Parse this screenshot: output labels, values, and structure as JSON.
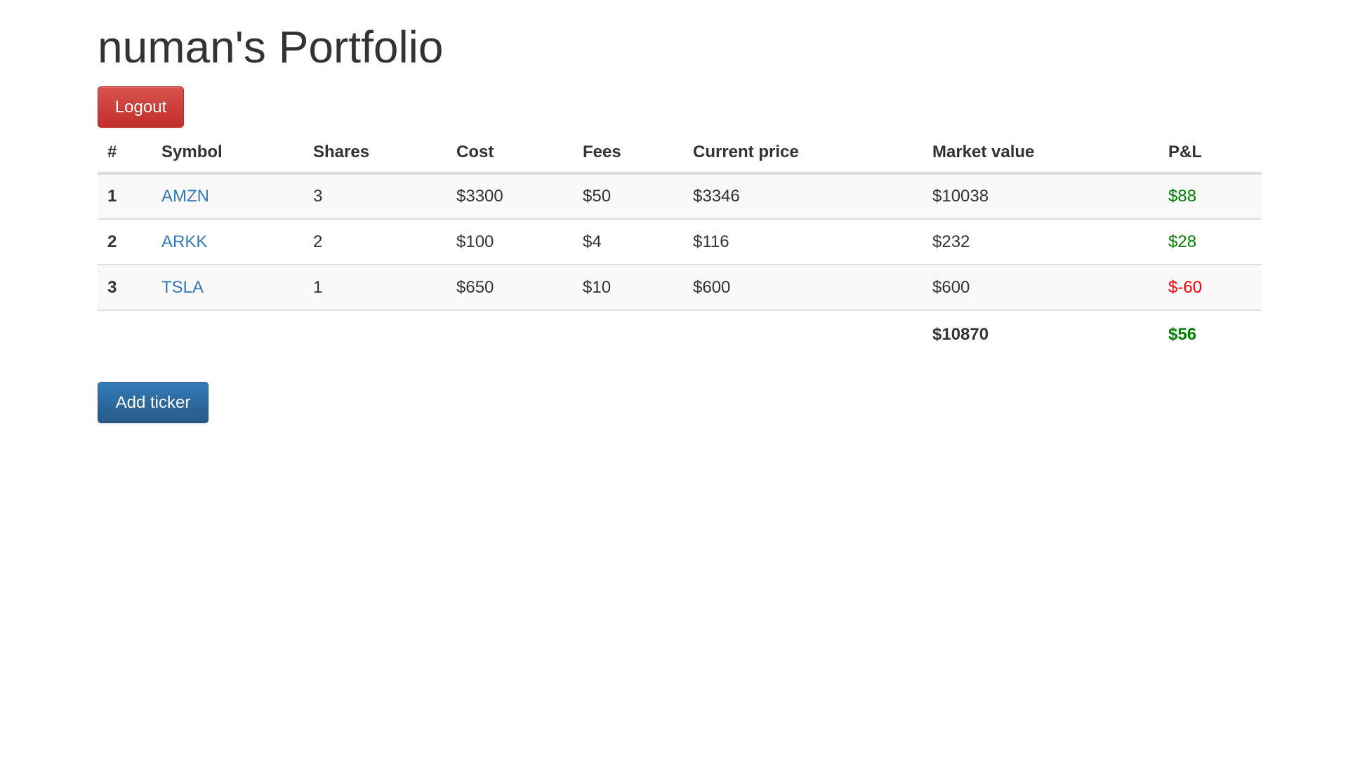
{
  "page": {
    "title": "numan's Portfolio"
  },
  "actions": {
    "logout_label": "Logout",
    "add_ticker_label": "Add ticker"
  },
  "colors": {
    "danger": "#d9534f",
    "primary": "#337ab7",
    "link": "#337ab7",
    "gain": "#008000",
    "loss": "#ff0000"
  },
  "table": {
    "headers": [
      "#",
      "Symbol",
      "Shares",
      "Cost",
      "Fees",
      "Current price",
      "Market value",
      "P&L"
    ],
    "rows": [
      {
        "num": "1",
        "symbol": "AMZN",
        "shares": "3",
        "cost": "$3300",
        "fees": "$50",
        "current_price": "$3346",
        "market_value": "$10038",
        "pnl": "$88",
        "pnl_status": "gain"
      },
      {
        "num": "2",
        "symbol": "ARKK",
        "shares": "2",
        "cost": "$100",
        "fees": "$4",
        "current_price": "$116",
        "market_value": "$232",
        "pnl": "$28",
        "pnl_status": "gain"
      },
      {
        "num": "3",
        "symbol": "TSLA",
        "shares": "1",
        "cost": "$650",
        "fees": "$10",
        "current_price": "$600",
        "market_value": "$600",
        "pnl": "$-60",
        "pnl_status": "loss"
      }
    ],
    "totals": {
      "market_value": "$10870",
      "pnl": "$56",
      "pnl_status": "gain"
    }
  }
}
